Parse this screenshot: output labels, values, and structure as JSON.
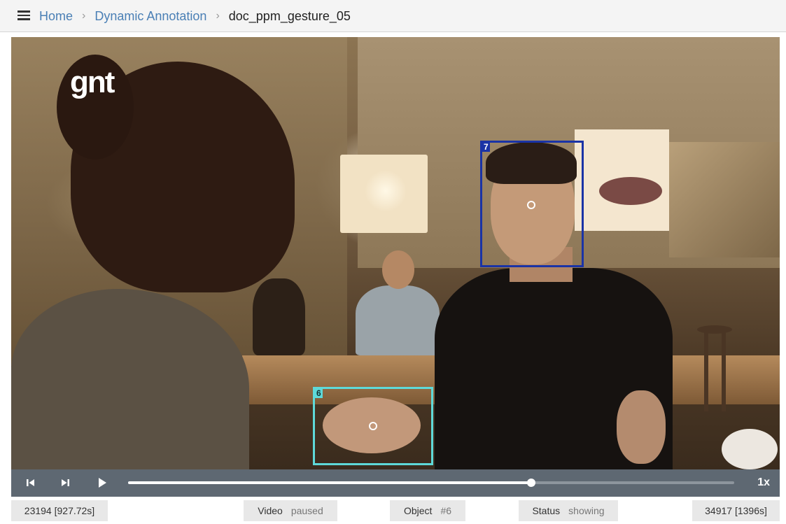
{
  "breadcrumb": {
    "items": [
      "Home",
      "Dynamic Annotation"
    ],
    "current": "doc_ppm_gesture_05"
  },
  "video": {
    "watermark": "gnt",
    "annotations": [
      {
        "id": "7",
        "color": "#1a33a6"
      },
      {
        "id": "6",
        "color": "#5ed9d9"
      }
    ]
  },
  "controls": {
    "progress_fraction": 0.665,
    "speed": "1x"
  },
  "status": {
    "start_frame": "23194 [927.72s]",
    "video_label": "Video",
    "video_value": "paused",
    "object_label": "Object",
    "object_value": "#6",
    "status_label": "Status",
    "status_value": "showing",
    "end_frame": "34917 [1396s]"
  },
  "colors": {
    "link": "#4a7fb5",
    "controls_bg": "#5e6872",
    "pill_bg": "#e8e8e8"
  }
}
